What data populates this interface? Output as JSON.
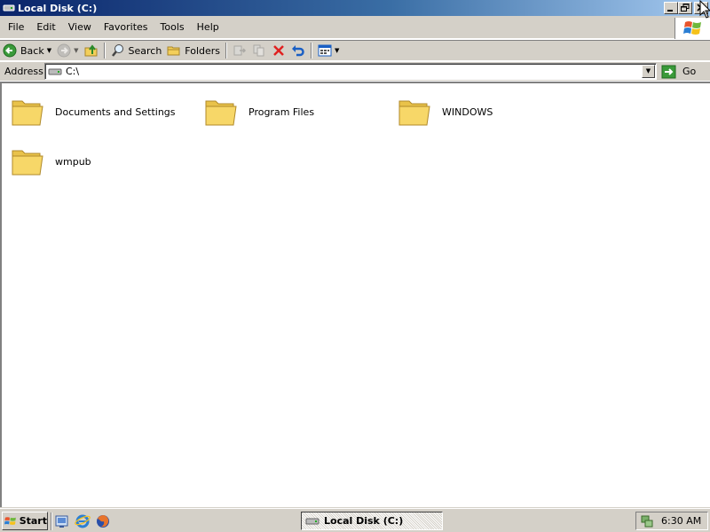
{
  "window": {
    "title": "Local Disk (C:)",
    "controls": [
      "minimize",
      "restore",
      "close"
    ]
  },
  "menubar": {
    "items": [
      "File",
      "Edit",
      "View",
      "Favorites",
      "Tools",
      "Help"
    ]
  },
  "toolbar": {
    "back_label": "Back",
    "search_label": "Search",
    "folders_label": "Folders"
  },
  "addressbar": {
    "label": "Address",
    "value": "C:\\",
    "go_label": "Go"
  },
  "content": {
    "folders": [
      {
        "name": "Documents and Settings"
      },
      {
        "name": "Program Files"
      },
      {
        "name": "WINDOWS"
      },
      {
        "name": "wmpub"
      }
    ]
  },
  "taskbar": {
    "start_label": "Start",
    "quick_launch": [
      "show-desktop-icon",
      "internet-explorer-icon",
      "firefox-icon"
    ],
    "task_label": "Local Disk (C:)",
    "clock": "6:30 AM"
  },
  "colors": {
    "title_gradient_start": "#0a246a",
    "title_gradient_end": "#a6caf0",
    "chrome_gray": "#d4d0c8",
    "folder_yellow": "#f7d768"
  }
}
